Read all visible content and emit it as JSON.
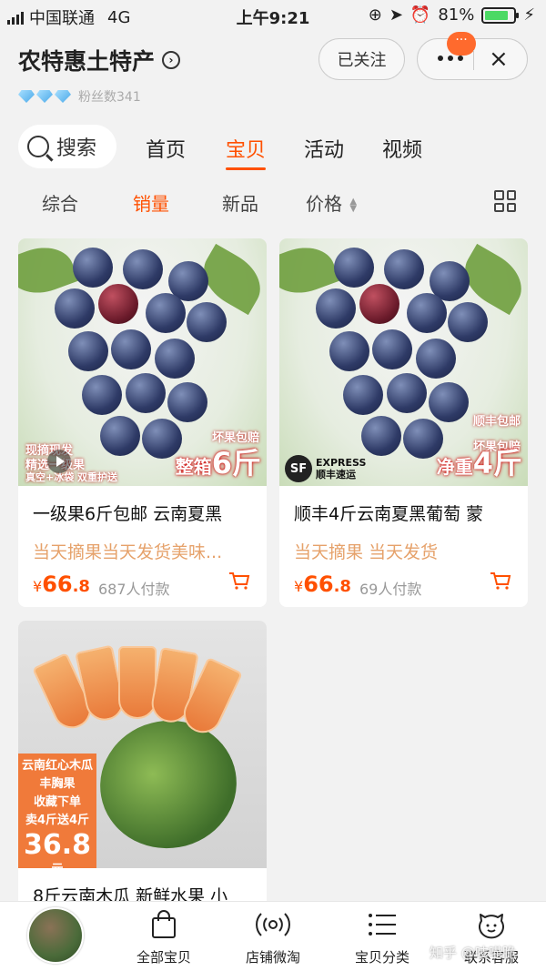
{
  "status_bar": {
    "carrier": "中国联通",
    "network": "4G",
    "time": "上午9:21",
    "battery_text": "81%",
    "battery_level": 0.81
  },
  "header": {
    "shop_name": "农特惠土特产",
    "fans": "粉丝数341",
    "follow_label": "已关注",
    "badge": "···",
    "close": "×"
  },
  "nav": {
    "search_label": "搜索",
    "tabs": [
      "首页",
      "宝贝",
      "活动",
      "视频"
    ],
    "active_tab": "宝贝"
  },
  "sort": {
    "options": [
      "综合",
      "销量",
      "新品",
      "价格"
    ],
    "active": "销量"
  },
  "products": [
    {
      "title": "一级果6斤包邮 云南夏黑",
      "subtitle": "当天摘果当天发货美味...",
      "currency": "¥",
      "price_int": "66",
      "price_dec": ".8",
      "buyers": "687人付款",
      "overlay": {
        "top_right": "坏果包赔",
        "tag_prefix": "整箱",
        "tag_weight": "6斤",
        "left1": "现摘现发",
        "left2": "精选一级果",
        "left3": "真空+冰袋 双重护送"
      }
    },
    {
      "title": "顺丰4斤云南夏黑葡萄 蒙",
      "subtitle": "当天摘果 当天发货",
      "currency": "¥",
      "price_int": "66",
      "price_dec": ".8",
      "buyers": "69人付款",
      "overlay": {
        "top_right": "顺丰包邮",
        "mid_right": "坏果包赔",
        "tag_prefix": "净重",
        "tag_weight": "4斤",
        "sf": "SF",
        "express": "EXPRESS",
        "express_cn": "顺丰速运"
      }
    },
    {
      "title": "8斤云南木瓜 新鲜水果 小",
      "overlay": {
        "l1": "云南红心木瓜",
        "l2": "丰胸果",
        "l3": "收藏下单",
        "l4": "卖4斤送4斤",
        "price": "36.8",
        "unit": "元"
      }
    }
  ],
  "bottom_bar": {
    "items": [
      "全部宝贝",
      "店铺微淘",
      "宝贝分类",
      "联系客服"
    ]
  },
  "watermark": "知乎 @吱喵脆",
  "colors": {
    "accent": "#ff5000",
    "subtitle": "#e6a26b",
    "background": "#f2f2f2"
  }
}
